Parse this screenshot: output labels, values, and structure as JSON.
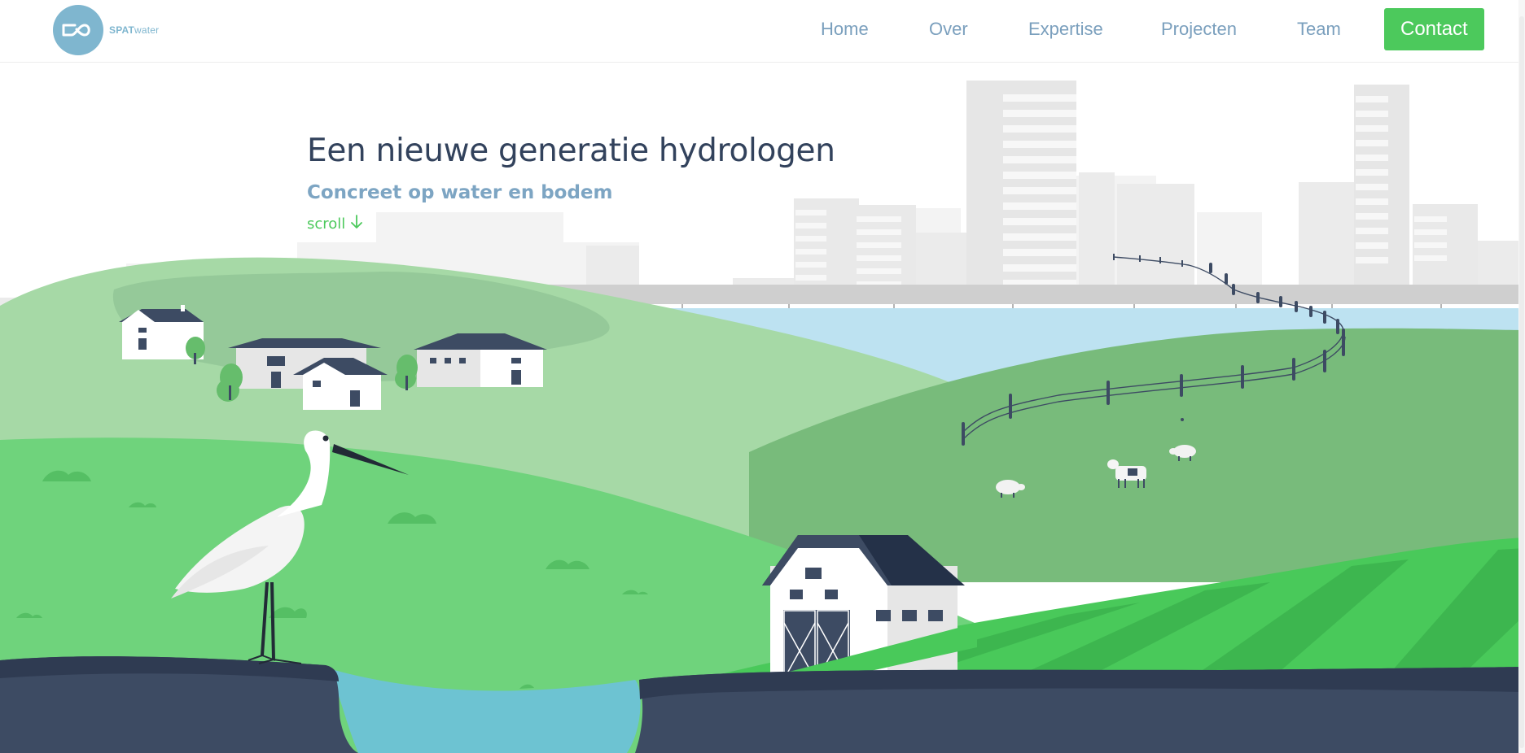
{
  "brand": {
    "name_bold": "SPAT",
    "name_light": "water",
    "logo_icon": "infinity-drop-icon",
    "accent_color": "#4cc95c",
    "primary_color": "#7fb6cf"
  },
  "nav": {
    "items": [
      {
        "label": "Home"
      },
      {
        "label": "Over"
      },
      {
        "label": "Expertise"
      },
      {
        "label": "Projecten"
      },
      {
        "label": "Team"
      }
    ],
    "contact_label": "Contact"
  },
  "hero": {
    "title": "Een nieuwe generatie hydrologen",
    "subtitle": "Concreet op water en bodem",
    "scroll_label": "scroll",
    "scroll_icon": "arrow-down-icon"
  }
}
